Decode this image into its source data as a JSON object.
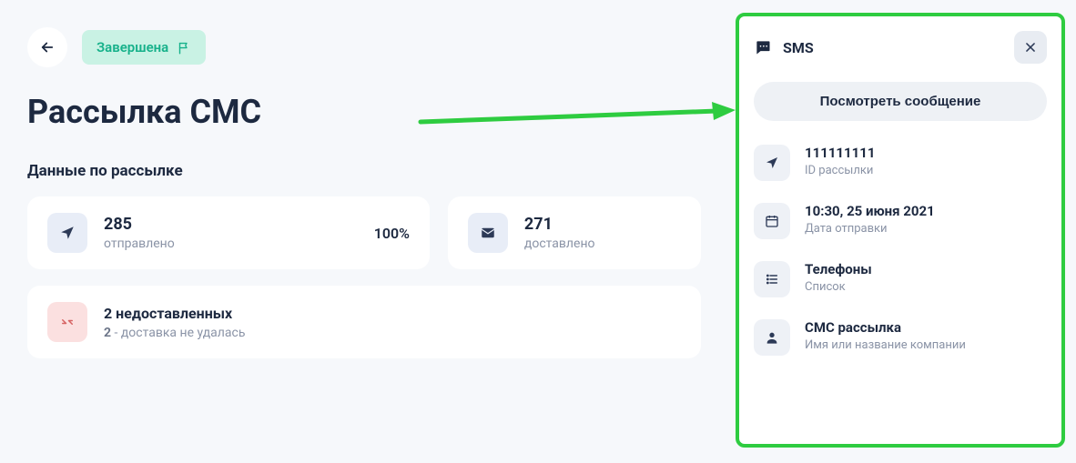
{
  "header": {
    "status_label": "Завершена"
  },
  "page": {
    "title": "Рассылка СМС",
    "subheading": "Данные по рассылке"
  },
  "stats": {
    "sent": {
      "value": "285",
      "label": "отправлено",
      "percent": "100%"
    },
    "delivered": {
      "value": "271",
      "label": "доставлено"
    }
  },
  "failed": {
    "title": "2 недоставленных",
    "count": "2",
    "reason": " - доставка не удалась"
  },
  "panel": {
    "type": "SMS",
    "view_button": "Посмотреть сообщение",
    "details": {
      "id": {
        "title": "111111111",
        "sub": "ID рассылки"
      },
      "date": {
        "title": "10:30, 25 июня 2021",
        "sub": "Дата отправки"
      },
      "phones": {
        "title": "Телефоны",
        "sub": "Список"
      },
      "sender": {
        "title": "СМС рассылка",
        "sub": "Имя или название компании"
      }
    }
  }
}
